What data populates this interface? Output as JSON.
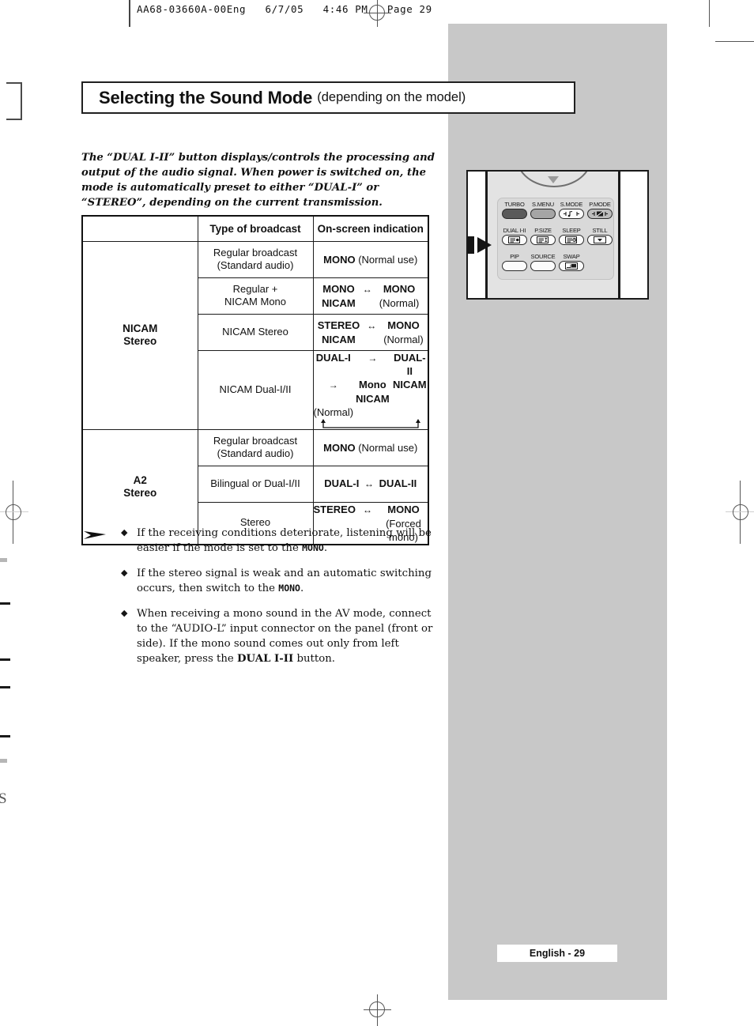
{
  "prepress": {
    "header": "AA68-03660A-00Eng   6/7/05   4:46 PM   Page 29",
    "stray_glyph": "S"
  },
  "title": {
    "main": "Selecting the Sound Mode",
    "sub": "(depending on the model)"
  },
  "intro": {
    "text": "The “DUAL I-II” button displays/controls the processing and output of the audio signal. When power is switched on, the mode is automatically preset to either “DUAL-I” or “STEREO”, depending on the current transmission."
  },
  "table": {
    "headers": {
      "corner": "",
      "type": "Type of broadcast",
      "indication": "On-screen indication"
    },
    "groups": [
      {
        "name": "NICAM Stereo",
        "name_line1": "NICAM",
        "name_line2": "Stereo",
        "rows": [
          {
            "type_line1": "Regular broadcast",
            "type_line2": "(Standard audio)",
            "ind_kind": "simple",
            "ind_bold": "MONO",
            "ind_note": "(Normal use)"
          },
          {
            "type_line1": "Regular +",
            "type_line2": "NICAM Mono",
            "ind_kind": "pair",
            "left_top": "MONO",
            "left_bottom": "NICAM",
            "arrow": "↔",
            "right_top": "MONO",
            "right_bottom": "(Normal)"
          },
          {
            "type_line1": "NICAM Stereo",
            "type_line2": "",
            "ind_kind": "pair",
            "left_top": "STEREO",
            "left_bottom": "NICAM",
            "arrow": "↔",
            "right_top": "MONO",
            "right_bottom": "(Normal)"
          },
          {
            "type_line1": "NICAM Dual-I/II",
            "type_line2": "",
            "ind_kind": "triple",
            "t1_top": "DUAL-I",
            "t1_bottom": "NICAM",
            "t2_top": "DUAL-II",
            "t2_bottom": "NICAM",
            "t3_top": "Mono",
            "t3_bottom": "(Normal)",
            "arrow1": "→",
            "arrow2": "→"
          }
        ]
      },
      {
        "name": "A2 Stereo",
        "name_line1": "A2",
        "name_line2": "Stereo",
        "rows": [
          {
            "type_line1": "Regular broadcast",
            "type_line2": "(Standard audio)",
            "ind_kind": "simple",
            "ind_bold": "MONO",
            "ind_note": "(Normal use)"
          },
          {
            "type_line1": "Bilingual or Dual-I/II",
            "type_line2": "",
            "ind_kind": "simple_pair",
            "left": "DUAL-I",
            "arrow": "↔",
            "right": "DUAL-II"
          },
          {
            "type_line1": "Stereo",
            "type_line2": "",
            "ind_kind": "pair",
            "left_top": "STEREO",
            "left_bottom": "",
            "arrow": "↔",
            "right_top": "MONO",
            "right_bottom": "(Forced mono)"
          }
        ]
      }
    ]
  },
  "notes": {
    "items": [
      {
        "bullet": "◆",
        "prefix": "If the receiving conditions deteriorate, listening will be easier  if the mode is set to the ",
        "mono": "MONO",
        "suffix": "."
      },
      {
        "bullet": "◆",
        "prefix": "If the stereo signal is weak and an automatic switching occurs, then switch to the ",
        "mono": "MONO",
        "suffix": "."
      },
      {
        "bullet": "◆",
        "prefix": "When receiving a mono sound in the AV mode, connect to the “AUDIO-L” input connector on the panel (front or side). If the mono sound comes out only from left speaker, press the ",
        "bold": "DUAL I-II",
        "suffix": " button."
      }
    ]
  },
  "remote": {
    "rows": [
      {
        "keys": [
          {
            "label": "TURBO",
            "style": "dark",
            "glyph": "none"
          },
          {
            "label": "S.MENU",
            "style": "mid",
            "glyph": "none"
          },
          {
            "label": "S.MODE",
            "style": "plain",
            "glyph": "sound-mode-icon"
          },
          {
            "label": "P.MODE",
            "style": "lgray",
            "glyph": "picture-mode-icon"
          }
        ]
      },
      {
        "keys": [
          {
            "label": "DUAL I-II",
            "style": "plain",
            "glyph": "dual-sound-icon",
            "highlighted": true
          },
          {
            "label": "P.SIZE",
            "style": "plain",
            "glyph": "picture-size-icon"
          },
          {
            "label": "SLEEP",
            "style": "plain",
            "glyph": "sleep-timer-icon"
          },
          {
            "label": "STILL",
            "style": "plain",
            "glyph": "still-icon"
          }
        ]
      },
      {
        "keys": [
          {
            "label": "PIP",
            "style": "plain",
            "glyph": "none"
          },
          {
            "label": "SOURCE",
            "style": "plain",
            "glyph": "none"
          },
          {
            "label": "SWAP",
            "style": "plain",
            "glyph": "swap-icon"
          }
        ]
      }
    ]
  },
  "footer": {
    "page_label": "English - 29"
  },
  "colors": {
    "gray_band": "#c8c8c8",
    "remote_body": "#e3e3e3",
    "panel": "#d9d9d9",
    "ink": "#111111"
  }
}
